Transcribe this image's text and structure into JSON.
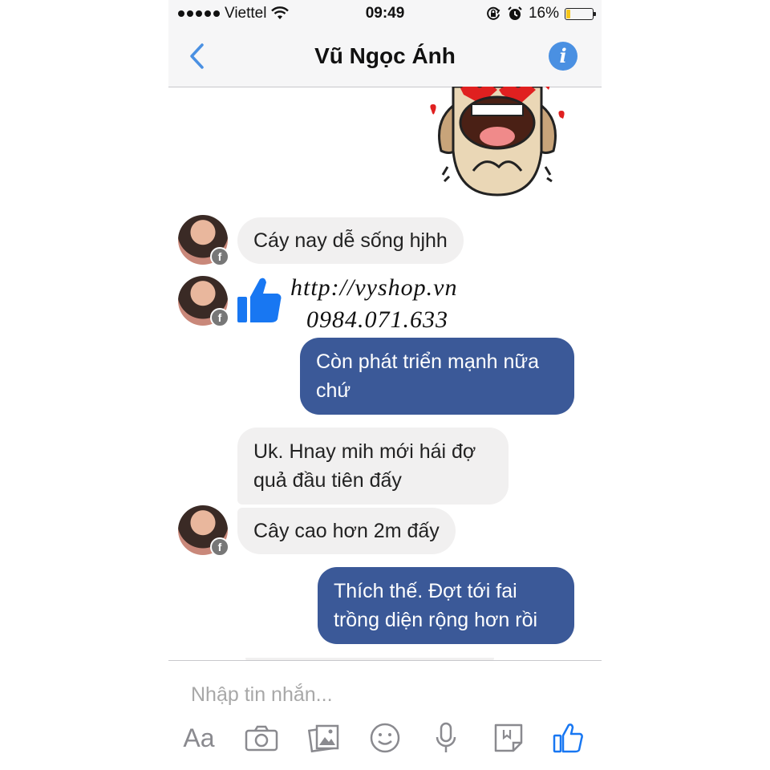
{
  "status_bar": {
    "carrier": "Viettel",
    "time": "09:49",
    "battery_percent": "16%",
    "battery_level": 0.16,
    "icons": [
      "signal-dots-icon",
      "wifi-icon",
      "rotation-lock-icon",
      "alarm-icon",
      "battery-icon"
    ]
  },
  "nav": {
    "title": "Vũ Ngọc Ánh",
    "back_icon": "chevron-left-icon",
    "info_icon": "info-icon",
    "info_glyph": "i"
  },
  "messages": [
    {
      "from": "them",
      "type": "sticker",
      "icon": "dog-heart-eyes-sticker"
    },
    {
      "from": "them",
      "type": "text",
      "text": "Cáy nay dễ sống hjhh"
    },
    {
      "from": "them",
      "type": "like",
      "icon": "thumbs-up-icon"
    },
    {
      "from": "me",
      "type": "text",
      "lines": [
        "Còn phát triển mạnh nữa",
        "chứ"
      ]
    },
    {
      "from": "them",
      "type": "text",
      "lines": [
        "Uk. Hnay mih mới hái đợ",
        "quả đầu tiên đấy"
      ]
    },
    {
      "from": "them",
      "type": "text",
      "text": "Cây cao hơn 2m đấy"
    },
    {
      "from": "me",
      "type": "text",
      "lines": [
        "Thích thế. Đợt tới fai",
        "trồng diện rộng hơn rồi"
      ]
    }
  ],
  "watermark": {
    "url": "http://vyshop.vn",
    "phone": "0984.071.633"
  },
  "composer": {
    "placeholder": "Nhập tin nhắn...",
    "aa_label": "Aa",
    "tools": [
      "text-format-icon",
      "camera-icon",
      "photo-gallery-icon",
      "emoji-icon",
      "microphone-icon",
      "sticker-icon",
      "like-icon"
    ]
  },
  "colors": {
    "outgoing_bubble": "#3b5998",
    "incoming_bubble": "#f1f0f0",
    "accent": "#4a90e2",
    "like_blue": "#1877f2",
    "bar_background": "#f6f6f7"
  }
}
